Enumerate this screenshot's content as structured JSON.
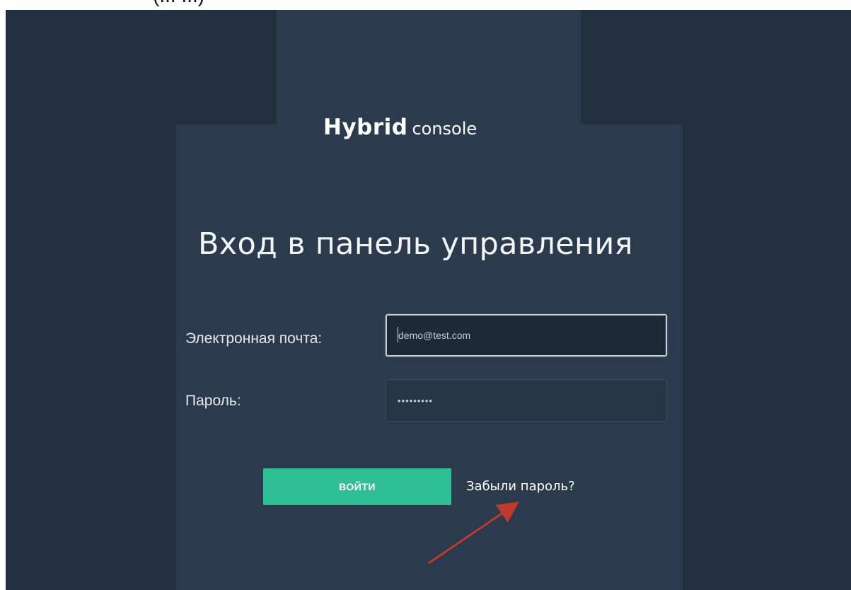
{
  "top_caption": "(... ...)",
  "logo": {
    "main": "Hybrid",
    "sub": "console"
  },
  "page_title": "Вход в панель управления",
  "form": {
    "email_label": "Электронная почта:",
    "email_value": "demo@test.com",
    "password_label": "Пароль:",
    "password_value": "•••••••••"
  },
  "actions": {
    "login_label": "ВОЙТИ",
    "forgot_label": "Забыли пароль?"
  },
  "colors": {
    "background": "#212f3f",
    "panel": "#2b3b4d",
    "accent": "#2fbf95",
    "annotation_arrow": "#c0392b"
  },
  "icons": {
    "annotation": "red-arrow-icon"
  }
}
